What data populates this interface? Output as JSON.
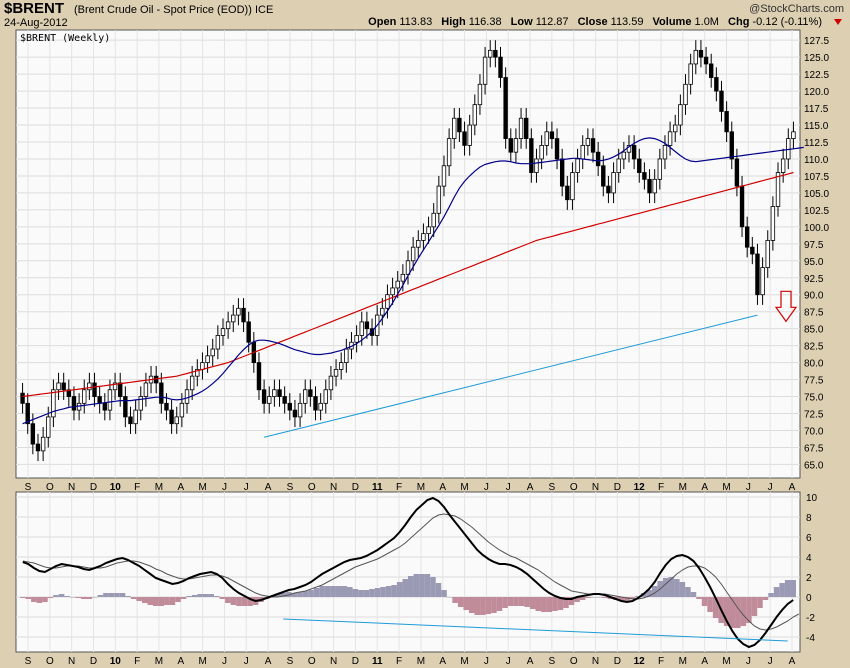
{
  "header": {
    "symbol": "$BRENT",
    "name": "(Brent Crude Oil - Spot Price (EOD))",
    "exchange": "ICE",
    "date": "24-Aug-2012",
    "brand": "@StockCharts.com",
    "open_label": "Open",
    "open": "113.83",
    "high_label": "High",
    "high": "116.38",
    "low_label": "Low",
    "low": "112.87",
    "close_label": "Close",
    "close": "113.59",
    "volume_label": "Volume",
    "volume": "1.0M",
    "chg_label": "Chg",
    "chg": "-0.12 (-0.11%)"
  },
  "chart_data": [
    {
      "type": "candlestick",
      "title": "$BRENT (Weekly)",
      "ylim": [
        63,
        129
      ],
      "yticks": [
        65,
        67.5,
        70,
        72.5,
        75,
        77.5,
        80,
        82.5,
        85,
        87.5,
        90,
        92.5,
        95,
        97.5,
        100,
        102.5,
        105,
        107.5,
        110,
        112.5,
        115,
        117.5,
        120,
        122.5,
        125,
        127.5
      ],
      "x_labels": [
        "S",
        "O",
        "N",
        "D",
        "10",
        "F",
        "M",
        "A",
        "M",
        "J",
        "J",
        "A",
        "S",
        "O",
        "N",
        "D",
        "11",
        "F",
        "M",
        "A",
        "M",
        "J",
        "J",
        "A",
        "S",
        "O",
        "N",
        "D",
        "12",
        "F",
        "M",
        "A",
        "M",
        "J",
        "J",
        "A"
      ],
      "bold_labels": [
        "10",
        "11",
        "12"
      ],
      "close_series": [
        74,
        71,
        68,
        67,
        69,
        72,
        76,
        77,
        76,
        75,
        73,
        74,
        76,
        77,
        75,
        74,
        73,
        76,
        77,
        75,
        72,
        71,
        73,
        75,
        77,
        78,
        77,
        74,
        73,
        71,
        72,
        74,
        76,
        78,
        79,
        80,
        81,
        82,
        84,
        85,
        86,
        87,
        88,
        86,
        83,
        80,
        76,
        74,
        75,
        76,
        75,
        74,
        73,
        72,
        74,
        76,
        75,
        73,
        74,
        76,
        78,
        79,
        80,
        82,
        83,
        84,
        86,
        85,
        84,
        87,
        88,
        90,
        91,
        92,
        93,
        95,
        97,
        98,
        99,
        100,
        102,
        106,
        109,
        113,
        116,
        114,
        112,
        115,
        118,
        121,
        125,
        126,
        125,
        122,
        113,
        111,
        113,
        116,
        113,
        108,
        110,
        112,
        114,
        113,
        110,
        106,
        104,
        108,
        110,
        112,
        113,
        111,
        109,
        106,
        105,
        108,
        110,
        111,
        112,
        110,
        108,
        107,
        105,
        107,
        110,
        112,
        114,
        115,
        118,
        121,
        124,
        126,
        125,
        124,
        122,
        120,
        117,
        114,
        110,
        106,
        100,
        97,
        96,
        90,
        94,
        98,
        103,
        108,
        110,
        113,
        114
      ],
      "ma_blue": [
        71,
        71.3,
        71.6,
        71.9,
        72.2,
        72.5,
        72.8,
        73,
        73.2,
        73.4,
        73.5,
        73.6,
        73.7,
        73.8,
        73.9,
        74,
        74.1,
        74.2,
        74.3,
        74.4,
        74.4,
        74.4,
        74.5,
        74.6,
        74.7,
        74.8,
        74.9,
        74.9,
        74.8,
        74.6,
        74.5,
        74.6,
        74.8,
        75.1,
        75.4,
        75.8,
        76.3,
        76.9,
        77.6,
        78.4,
        79.3,
        80.2,
        81.1,
        81.9,
        82.6,
        83.1,
        83.3,
        83.3,
        83.2,
        83,
        82.8,
        82.5,
        82.2,
        81.9,
        81.7,
        81.5,
        81.3,
        81.2,
        81.2,
        81.3,
        81.4,
        81.6,
        81.8,
        82.1,
        82.4,
        82.8,
        83.3,
        83.9,
        84.6,
        85.5,
        86.5,
        87.6,
        88.8,
        90.1,
        91.4,
        92.8,
        94.1,
        95.4,
        96.6,
        97.8,
        99,
        100.2,
        101.5,
        102.9,
        104.4,
        105.7,
        106.7,
        107.5,
        108.2,
        108.8,
        109.2,
        109.4,
        109.6,
        109.7,
        109.7,
        109.6,
        109.4,
        109.3,
        109.3,
        109.3,
        109.4,
        109.5,
        109.6,
        109.7,
        109.8,
        109.9,
        110,
        110.1,
        110.1,
        110,
        109.9,
        109.8,
        109.7,
        109.8,
        110,
        110.3,
        110.7,
        111.2,
        111.8,
        112.3,
        112.7,
        113,
        113.1,
        113,
        112.7,
        112.3,
        111.7,
        111.1,
        110.5,
        110,
        109.7,
        109.6,
        109.7,
        109.8,
        109.9,
        110,
        110.1,
        110.2,
        110.3,
        110.4,
        110.5,
        110.6,
        110.7,
        110.8,
        110.9,
        111,
        111.1,
        111.2,
        111.3,
        111.4,
        111.5,
        111.6,
        111.7
      ],
      "ma_red": [
        75,
        75.1,
        75.2,
        75.3,
        75.4,
        75.5,
        75.6,
        75.7,
        75.8,
        75.9,
        76,
        76.1,
        76.2,
        76.3,
        76.4,
        76.5,
        76.6,
        76.7,
        76.8,
        76.9,
        77,
        77.1,
        77.2,
        77.3,
        77.4,
        77.5,
        77.6,
        77.7,
        77.8,
        77.9,
        78,
        78.2,
        78.4,
        78.6,
        78.8,
        79,
        79.2,
        79.4,
        79.6,
        79.8,
        80,
        80.3,
        80.6,
        80.9,
        81.2,
        81.5,
        81.8,
        82.1,
        82.4,
        82.7,
        83,
        83.3,
        83.6,
        83.9,
        84.2,
        84.5,
        84.8,
        85.1,
        85.4,
        85.7,
        86,
        86.3,
        86.6,
        86.9,
        87.2,
        87.5,
        87.8,
        88.1,
        88.4,
        88.7,
        89,
        89.3,
        89.6,
        89.9,
        90.2,
        90.5,
        90.8,
        91.1,
        91.4,
        91.7,
        92,
        92.3,
        92.6,
        92.9,
        93.2,
        93.5,
        93.8,
        94.1,
        94.4,
        94.7,
        95,
        95.3,
        95.6,
        95.9,
        96.2,
        96.5,
        96.8,
        97.1,
        97.4,
        97.7,
        98,
        98.2,
        98.4,
        98.6,
        98.8,
        99,
        99.2,
        99.4,
        99.6,
        99.8,
        100,
        100.2,
        100.4,
        100.6,
        100.8,
        101,
        101.2,
        101.4,
        101.6,
        101.8,
        102,
        102.2,
        102.4,
        102.6,
        102.8,
        103,
        103.2,
        103.4,
        103.6,
        103.8,
        104,
        104.2,
        104.4,
        104.6,
        104.8,
        105,
        105.2,
        105.4,
        105.6,
        105.8,
        106,
        106.2,
        106.4,
        106.6,
        106.8,
        107,
        107.2,
        107.4,
        107.6,
        107.8,
        108
      ]
    },
    {
      "type": "macd",
      "ylim": [
        -5.5,
        10.5
      ],
      "yticks": [
        -4,
        -2,
        0,
        2,
        4,
        6,
        8,
        10
      ],
      "x_labels": [
        "S",
        "O",
        "N",
        "D",
        "10",
        "F",
        "M",
        "A",
        "M",
        "J",
        "J",
        "A",
        "S",
        "O",
        "N",
        "D",
        "11",
        "F",
        "M",
        "A",
        "M",
        "J",
        "J",
        "A",
        "S",
        "O",
        "N",
        "D",
        "12",
        "F",
        "M",
        "A",
        "M",
        "J",
        "J",
        "A"
      ],
      "macd": [
        3.5,
        3.3,
        2.9,
        2.6,
        2.5,
        2.8,
        3.1,
        3.3,
        3.2,
        3.1,
        3.0,
        2.8,
        2.7,
        2.9,
        3.1,
        3.4,
        3.6,
        3.8,
        3.9,
        3.7,
        3.4,
        3.1,
        2.7,
        2.3,
        1.9,
        1.7,
        1.5,
        1.3,
        1.4,
        1.6,
        1.9,
        2.1,
        2.3,
        2.4,
        2.5,
        2.3,
        1.9,
        1.3,
        0.8,
        0.4,
        0.1,
        -0.2,
        -0.4,
        -0.3,
        -0.1,
        0.1,
        0.3,
        0.5,
        0.7,
        0.8,
        1.0,
        1.2,
        1.5,
        1.9,
        2.3,
        2.6,
        2.9,
        3.2,
        3.5,
        3.7,
        3.8,
        3.9,
        4.1,
        4.4,
        4.7,
        5.1,
        5.5,
        5.9,
        6.5,
        7.2,
        8.0,
        8.7,
        9.2,
        9.7,
        9.9,
        9.6,
        9.0,
        8.2,
        7.5,
        6.8,
        6.1,
        5.4,
        4.7,
        4.2,
        3.8,
        3.5,
        3.3,
        3.3,
        3.2,
        3.0,
        2.7,
        2.3,
        1.8,
        1.3,
        0.8,
        0.4,
        0.1,
        -0.1,
        -0.2,
        -0.2,
        0.0,
        0.1,
        0.2,
        0.3,
        0.3,
        0.2,
        0.0,
        -0.2,
        -0.4,
        -0.5,
        -0.4,
        -0.1,
        0.3,
        0.8,
        1.5,
        2.4,
        3.2,
        3.8,
        4.1,
        4.2,
        4.0,
        3.6,
        2.9,
        2.0,
        1.0,
        -0.1,
        -1.3,
        -2.4,
        -3.4,
        -4.2,
        -4.7,
        -5.0,
        -4.8,
        -4.3,
        -3.6,
        -2.8,
        -2.0,
        -1.3,
        -0.7,
        -0.3
      ],
      "signal": [
        3.6,
        3.5,
        3.4,
        3.2,
        3.0,
        2.9,
        2.9,
        3.0,
        3.1,
        3.1,
        3.1,
        3.0,
        2.9,
        2.9,
        2.9,
        3.0,
        3.2,
        3.4,
        3.5,
        3.6,
        3.6,
        3.5,
        3.3,
        3.1,
        2.8,
        2.6,
        2.3,
        2.1,
        1.9,
        1.8,
        1.8,
        1.9,
        2.0,
        2.1,
        2.2,
        2.2,
        2.1,
        1.9,
        1.6,
        1.3,
        1.0,
        0.7,
        0.4,
        0.2,
        0.1,
        0.0,
        0.0,
        0.1,
        0.2,
        0.4,
        0.5,
        0.6,
        0.8,
        1.0,
        1.2,
        1.5,
        1.8,
        2.1,
        2.4,
        2.7,
        3.0,
        3.2,
        3.4,
        3.6,
        3.8,
        4.1,
        4.4,
        4.7,
        5.0,
        5.4,
        5.9,
        6.4,
        6.9,
        7.4,
        7.9,
        8.2,
        8.3,
        8.2,
        8.1,
        7.8,
        7.4,
        7.0,
        6.5,
        6.0,
        5.5,
        5.1,
        4.7,
        4.4,
        4.1,
        3.9,
        3.6,
        3.3,
        3.0,
        2.7,
        2.3,
        1.9,
        1.5,
        1.2,
        0.9,
        0.6,
        0.5,
        0.4,
        0.3,
        0.3,
        0.3,
        0.3,
        0.2,
        0.1,
        0.0,
        -0.1,
        -0.2,
        -0.2,
        -0.1,
        0.1,
        0.4,
        0.8,
        1.3,
        1.8,
        2.3,
        2.7,
        3.0,
        3.1,
        3.1,
        2.9,
        2.5,
        2.0,
        1.3,
        0.5,
        -0.3,
        -1.1,
        -1.8,
        -2.4,
        -2.9,
        -3.2,
        -3.3,
        -3.2,
        -3.0,
        -2.7,
        -2.4,
        -2.0,
        -1.7
      ]
    }
  ]
}
